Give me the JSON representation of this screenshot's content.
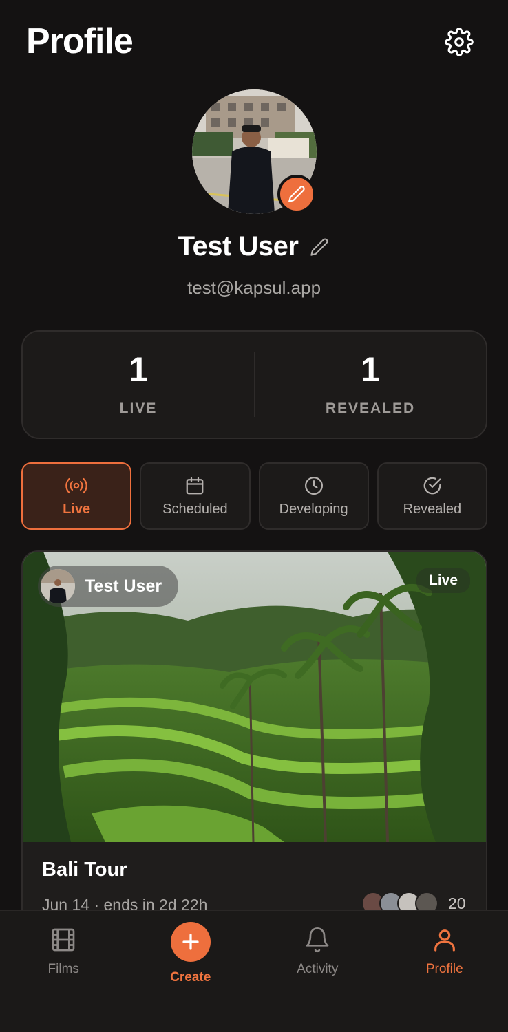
{
  "header": {
    "title": "Profile",
    "settings_icon": "gear-icon"
  },
  "profile": {
    "name": "Test User",
    "email": "test@kapsul.app",
    "avatar_edit_icon": "pencil-icon",
    "name_edit_icon": "pencil-icon"
  },
  "stats": [
    {
      "value": "1",
      "label": "LIVE"
    },
    {
      "value": "1",
      "label": "REVEALED"
    }
  ],
  "tabs": [
    {
      "label": "Live",
      "icon": "broadcast-icon",
      "active": true
    },
    {
      "label": "Scheduled",
      "icon": "calendar-icon",
      "active": false
    },
    {
      "label": "Developing",
      "icon": "clock-icon",
      "active": false
    },
    {
      "label": "Revealed",
      "icon": "check-circle-icon",
      "active": false
    }
  ],
  "card": {
    "owner": "Test User",
    "status": "Live",
    "title": "Bali Tour",
    "meta": "Jun 14 · ends in 2d 22h",
    "participant_count": "20"
  },
  "nav": [
    {
      "label": "Films",
      "icon": "film-icon",
      "active": false
    },
    {
      "label": "Create",
      "icon": "plus-icon",
      "active": false
    },
    {
      "label": "Activity",
      "icon": "bell-icon",
      "active": false
    },
    {
      "label": "Profile",
      "icon": "user-icon",
      "active": true
    }
  ],
  "colors": {
    "accent": "#ee6f3d",
    "background": "#141212",
    "surface": "#1c1a19"
  }
}
